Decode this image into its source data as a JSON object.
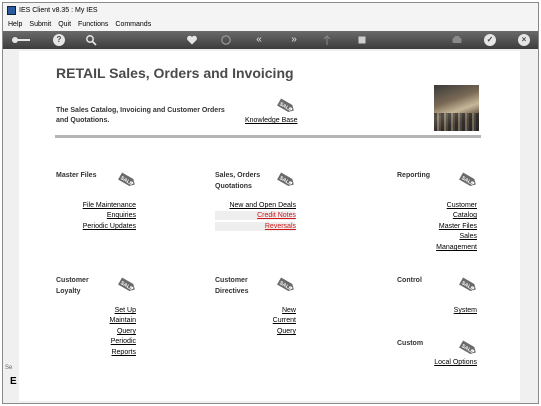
{
  "window": {
    "title": "IES Client v8.35 : My IES"
  },
  "menu": [
    "Help",
    "Submit",
    "Quit",
    "Functions",
    "Commands"
  ],
  "toolbar": {
    "icons": [
      "key-icon",
      "help-icon",
      "search-icon",
      "heart-icon",
      "history-icon",
      "back-icon",
      "forward-icon",
      "upload-icon",
      "stop-icon",
      "print-icon",
      "ok-icon",
      "close-icon"
    ]
  },
  "page": {
    "title": "RETAIL Sales, Orders and Invoicing",
    "subtitle": "The Sales Catalog, Invoicing and Customer Orders and Quotations.",
    "knowledge_base": "Knowledge Base",
    "sale_tag": "SALE"
  },
  "sections": {
    "master_files": {
      "title": "Master Files",
      "links": [
        "File Maintenance",
        "Enquiries",
        "Periodic Updates"
      ]
    },
    "sales_orders": {
      "title": "Sales, Orders Quotations",
      "links": [
        "New and Open Deals",
        "Credit Notes",
        "Reversals"
      ]
    },
    "reporting": {
      "title": "Reporting",
      "links": [
        "Customer",
        "Catalog",
        "Master Files",
        "Sales",
        "Management"
      ]
    },
    "customer_loyalty": {
      "title": "Customer Loyalty",
      "links": [
        "Set Up",
        "Maintain",
        "Query",
        "Periodic",
        "Reports"
      ]
    },
    "customer_directives": {
      "title": "Customer Directives",
      "links": [
        "New",
        "Current",
        "Query"
      ]
    },
    "control": {
      "title": "Control",
      "links": [
        "System"
      ]
    },
    "custom": {
      "title": "Custom",
      "links": [
        "Local Options"
      ]
    }
  },
  "sidebar": {
    "label": "Se",
    "letter": "E"
  },
  "colors": {
    "link_active": "#d01818",
    "toolbar_bg": "#4a4a4a",
    "title_text": "#4a4a4a"
  }
}
